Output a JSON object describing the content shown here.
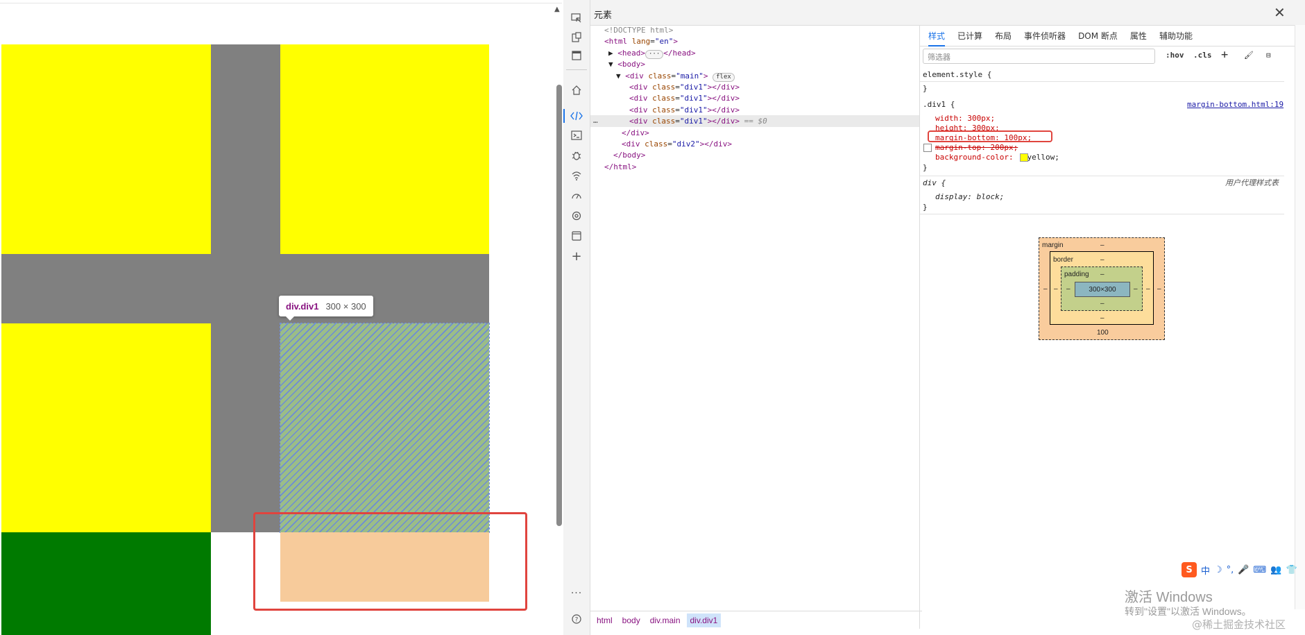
{
  "preview": {
    "tooltip_name": "div.div1",
    "tooltip_size": "300 × 300",
    "colors": {
      "yellow": "#ffff00",
      "gray": "#808080",
      "green": "#007a00",
      "margin": "#f7cb9b",
      "highlight": "#9bbd87"
    }
  },
  "devtools": {
    "title": "元素",
    "activity_icons": [
      "inspect-icon",
      "device-icon",
      "panel-icon",
      "home-icon",
      "elements-icon",
      "console-icon",
      "bug-icon",
      "network-icon",
      "performance-icon",
      "settings-icon",
      "application-icon",
      "add-icon",
      "more-icon",
      "help-icon"
    ],
    "dom": {
      "doctype": "<!DOCTYPE html>",
      "html_open_tag": "<html",
      "html_attr": "lang",
      "html_attr_val": "\"en\"",
      "head": "<head>",
      "head_close": "</head>",
      "body": "<body>",
      "div_main_tag": "<div",
      "attr_class": "class",
      "main_val": "\"main\"",
      "flex_badge": "flex",
      "div1_val": "\"div1\"",
      "div2_val": "\"div2\"",
      "div_close": "</div>",
      "body_close": "</body>",
      "html_close": "</html>",
      "eq_sel": "== $0",
      "ellipsis": "…",
      "dots": "···"
    },
    "breadcrumbs": [
      "html",
      "body",
      "div.main",
      "div.div1"
    ],
    "tabs": [
      "样式",
      "已计算",
      "布局",
      "事件侦听器",
      "DOM 断点",
      "属性",
      "辅助功能"
    ],
    "filter_placeholder": "筛选器",
    "toolbar": {
      "hov": ":hov",
      "cls": ".cls",
      "add": "+",
      "paint": "🖌",
      "toggle": "⊟"
    },
    "styles": {
      "element_style": "element.style {",
      "close_brace": "}",
      "div1_selector": ".div1 {",
      "source_link": "margin-bottom.html:19",
      "width": "width: 300px;",
      "height": "height: 300px;",
      "margin_bottom": "margin-bottom: 100px;",
      "margin_top": "margin-top: 200px;",
      "background_color": "background-color:",
      "background_val": "yellow;",
      "div_selector": "div {",
      "user_agent": "用户代理样式表",
      "display": "display: block;"
    },
    "box_model": {
      "margin_label": "margin",
      "border_label": "border",
      "padding_label": "padding",
      "content": "300×300",
      "dash": "–",
      "margin_bottom": "100"
    }
  },
  "system": {
    "ime": [
      "S",
      "中",
      "☽",
      "°,",
      "🎤",
      "⌨",
      "👥",
      "👕"
    ],
    "windows_line1": "激活 Windows",
    "windows_line2": "转到\"设置\"以激活 Windows。",
    "watermark": "@稀土掘金技术社区"
  }
}
